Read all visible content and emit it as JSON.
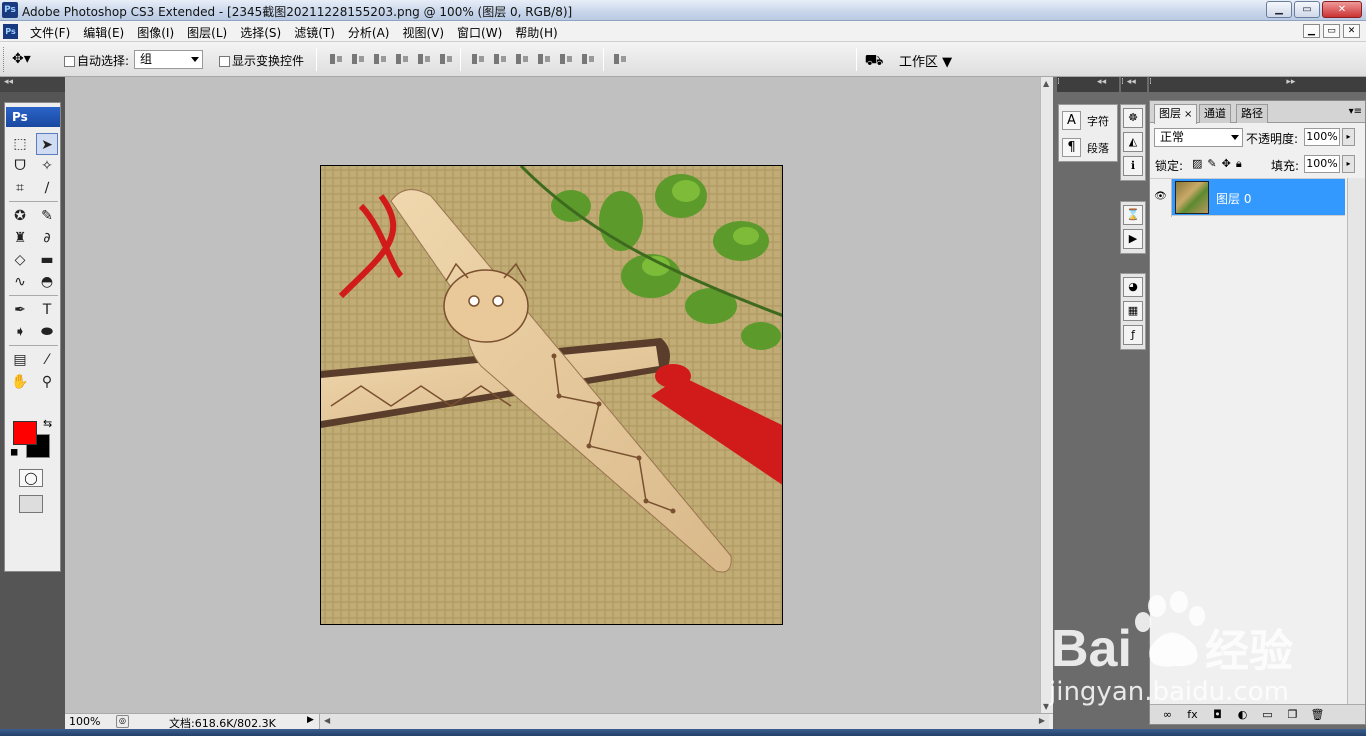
{
  "window": {
    "title": "Adobe Photoshop CS3 Extended - [2345截图20211228155203.png @ 100% (图层 0, RGB/8)]",
    "app_icon": "Ps",
    "buttons": {
      "minimize": "▁",
      "maximize": "▭",
      "close": "✕"
    }
  },
  "menu": {
    "items": [
      "文件(F)",
      "编辑(E)",
      "图像(I)",
      "图层(L)",
      "选择(S)",
      "滤镜(T)",
      "分析(A)",
      "视图(V)",
      "窗口(W)",
      "帮助(H)"
    ],
    "doc_buttons": [
      "▁",
      "▭",
      "✕"
    ]
  },
  "options": {
    "auto_select_label": "自动选择:",
    "auto_select_value": "组",
    "show_transform_label": "显示变换控件",
    "workspace_label": "工作区 ▼"
  },
  "tools": {
    "logo": "Ps",
    "foreground_color": "#ff0000",
    "background_color": "#000000"
  },
  "statusbar": {
    "zoom": "100%",
    "doc_size": "文档:618.6K/802.3K"
  },
  "char_panel": {
    "character_label": "字符",
    "paragraph_label": "段落"
  },
  "layers_panel": {
    "tabs": [
      "图层",
      "通道",
      "路径"
    ],
    "active_tab": "图层",
    "blend_mode": "正常",
    "opacity_label": "不透明度:",
    "opacity_value": "100%",
    "lock_label": "锁定:",
    "fill_label": "填充:",
    "fill_value": "100%",
    "layers": [
      {
        "name": "图层 0",
        "visible": true,
        "selected": true
      }
    ]
  },
  "watermark": {
    "brand": "Bai",
    "brand_suffix": "经验",
    "url": "jingyan.baidu.com"
  }
}
